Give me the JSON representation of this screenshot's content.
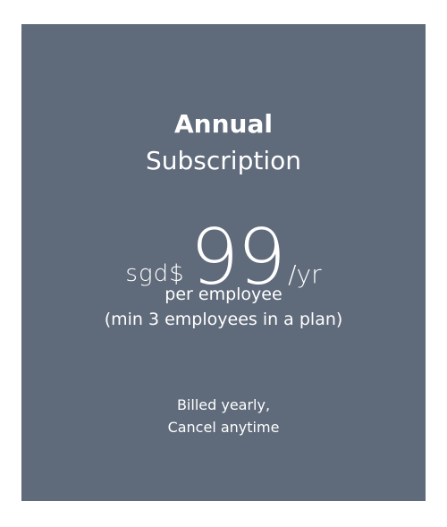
{
  "plan": {
    "title_line1": "Annual",
    "title_line2": "Subscription",
    "currency": "sgd$",
    "amount": "99",
    "period": "/yr",
    "unit": "per employee",
    "minimum": "(min 3 employees in a plan)",
    "billing_line1": "Billed yearly,",
    "billing_line2": "Cancel anytime"
  },
  "colors": {
    "card_background": "#5f6a7a",
    "text": "#ffffff",
    "page_background": "#ffffff"
  }
}
